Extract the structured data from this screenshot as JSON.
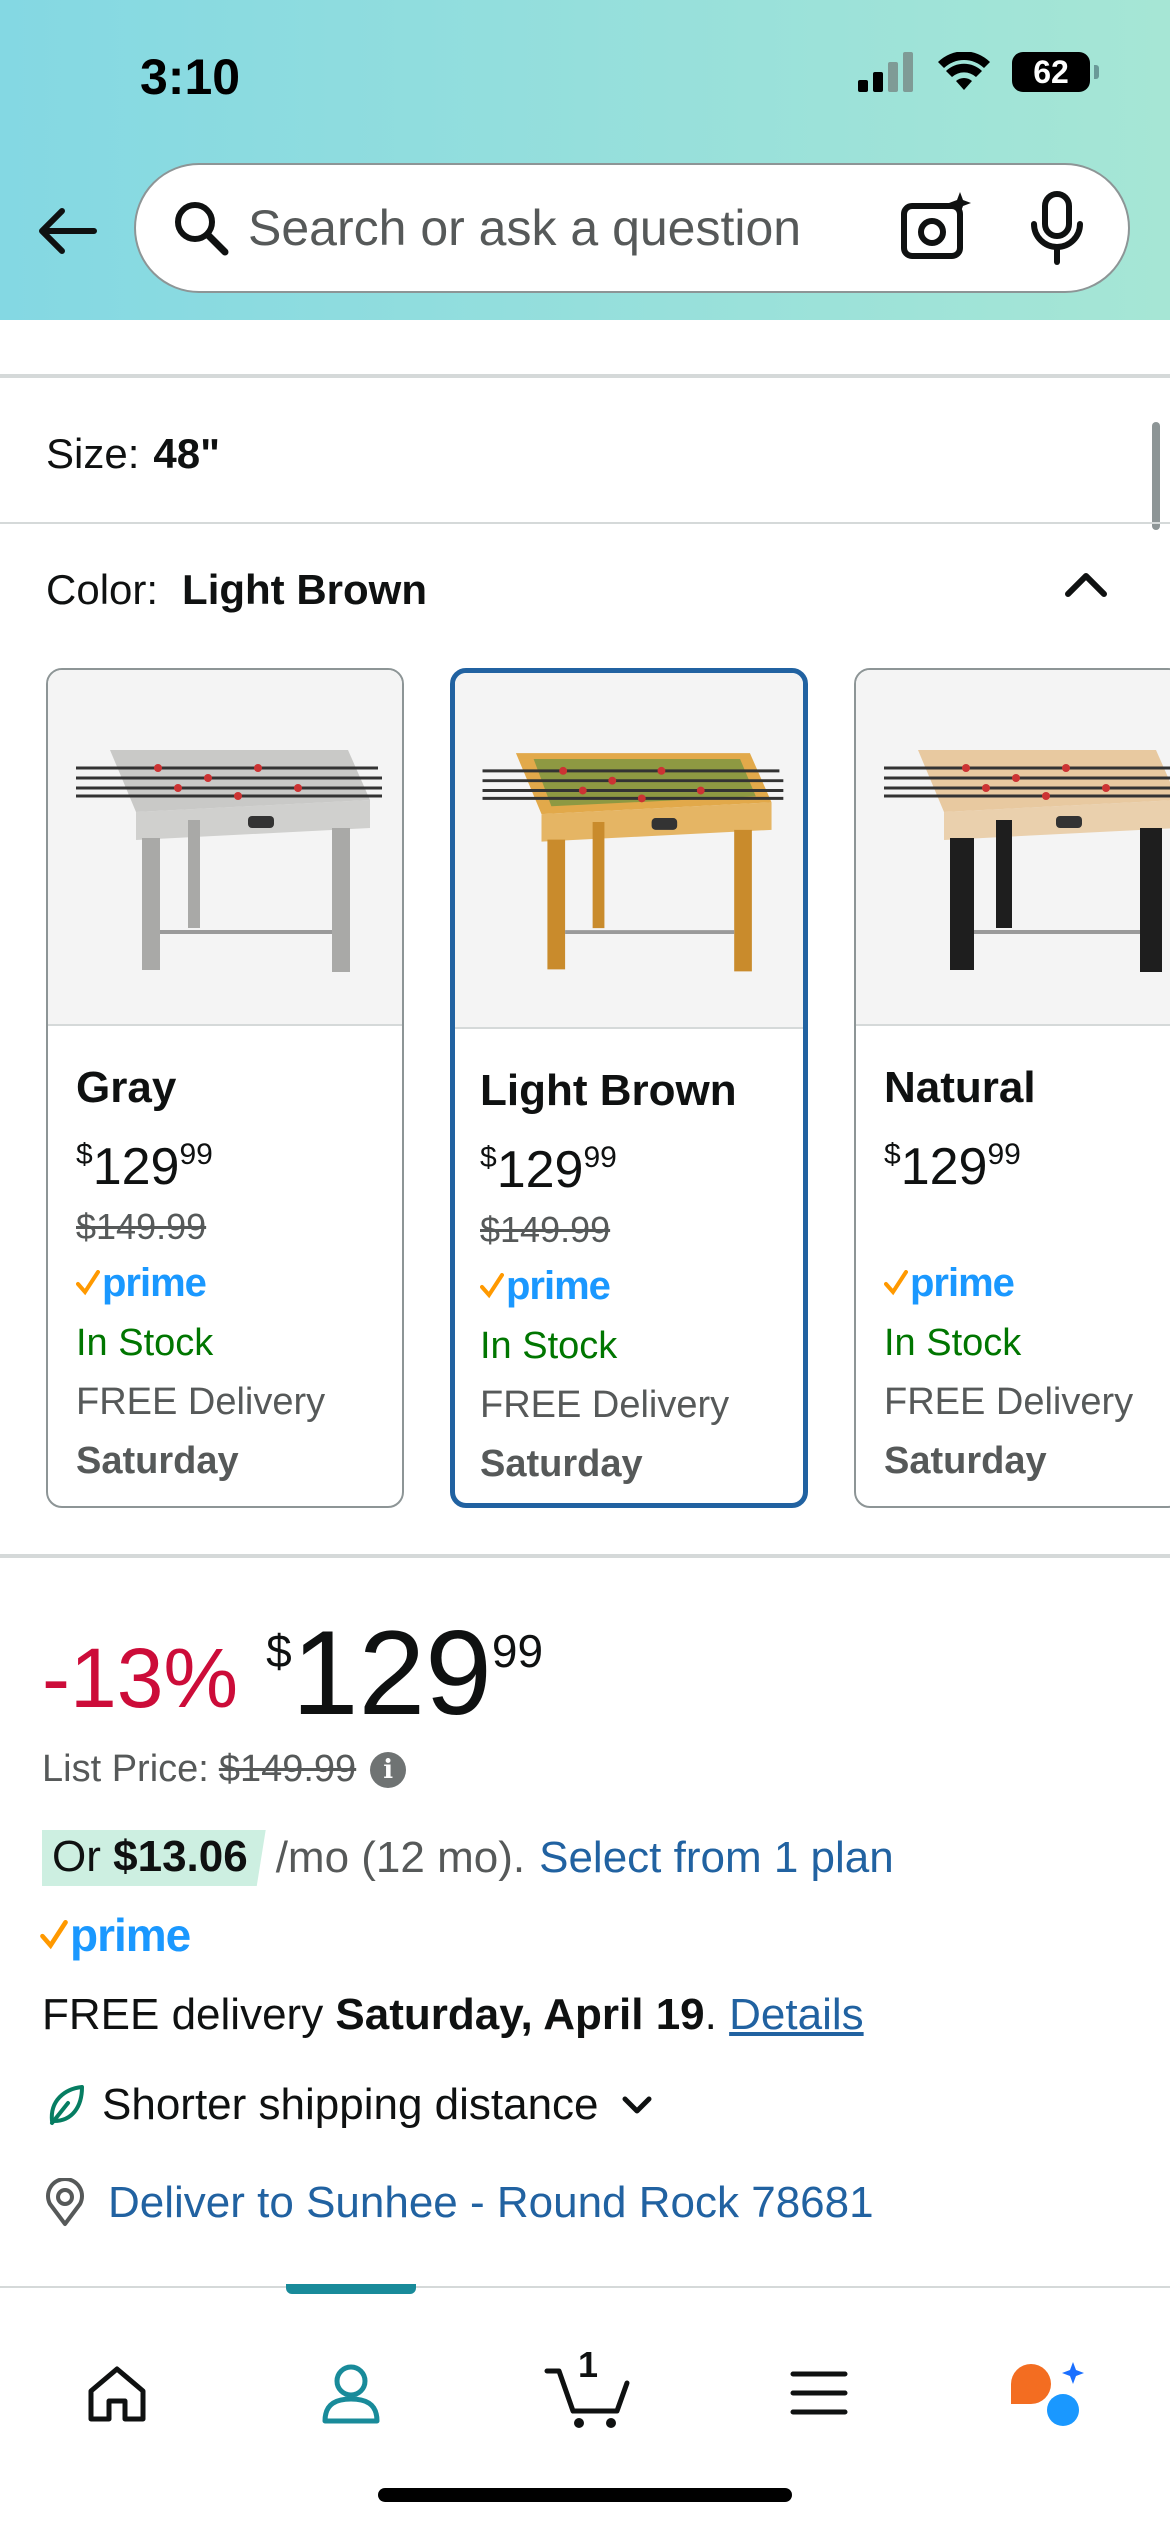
{
  "status_bar": {
    "time": "3:10",
    "battery": "62"
  },
  "search": {
    "placeholder": "Search or ask a question"
  },
  "size": {
    "label": "Size:",
    "value": "48\""
  },
  "color": {
    "label": "Color:",
    "value": "Light Brown"
  },
  "swatches": [
    {
      "name": "Gray",
      "currency": "$",
      "whole": "129",
      "fraction": "99",
      "list_price": "$149.99",
      "prime": "prime",
      "stock": "In Stock",
      "delivery": "FREE Delivery",
      "day": "Saturday",
      "table_color": "#c9c9c7",
      "leg_color": "#a9a9a7",
      "selected": false
    },
    {
      "name": "Light Brown",
      "currency": "$",
      "whole": "129",
      "fraction": "99",
      "list_price": "$149.99",
      "prime": "prime",
      "stock": "In Stock",
      "delivery": "FREE Delivery",
      "day": "Saturday",
      "table_color": "#e2a94a",
      "leg_color": "#c98b2c",
      "selected": true
    },
    {
      "name": "Natural",
      "currency": "$",
      "whole": "129",
      "fraction": "99",
      "list_price": "",
      "prime": "prime",
      "stock": "In Stock",
      "delivery": "FREE Delivery",
      "day": "Saturday",
      "table_color": "#e8c9a0",
      "leg_color": "#1e1e1e",
      "selected": false
    }
  ],
  "price": {
    "discount": "-13%",
    "currency": "$",
    "whole": "129",
    "fraction": "99"
  },
  "list_price": {
    "label": "List Price:",
    "value": "$149.99"
  },
  "plan": {
    "or": "Or",
    "amount": "$13.06",
    "term": "/mo (12 mo).",
    "link": "Select from 1 plan"
  },
  "prime_label": "prime",
  "delivery": {
    "prefix": "FREE delivery",
    "date": "Saturday, April 19",
    "sep": ".",
    "link": "Details"
  },
  "shipping": {
    "label": "Shorter shipping distance"
  },
  "location": {
    "label": "Deliver to Sunhee - Round Rock 78681"
  },
  "nav": {
    "cart_count": "1",
    "active": "account"
  },
  "colors": {
    "accent": "#2162a1",
    "discount": "#cc0c39",
    "stock": "#007600",
    "prime": "#1a98ff",
    "nav_active": "#198b9a"
  }
}
